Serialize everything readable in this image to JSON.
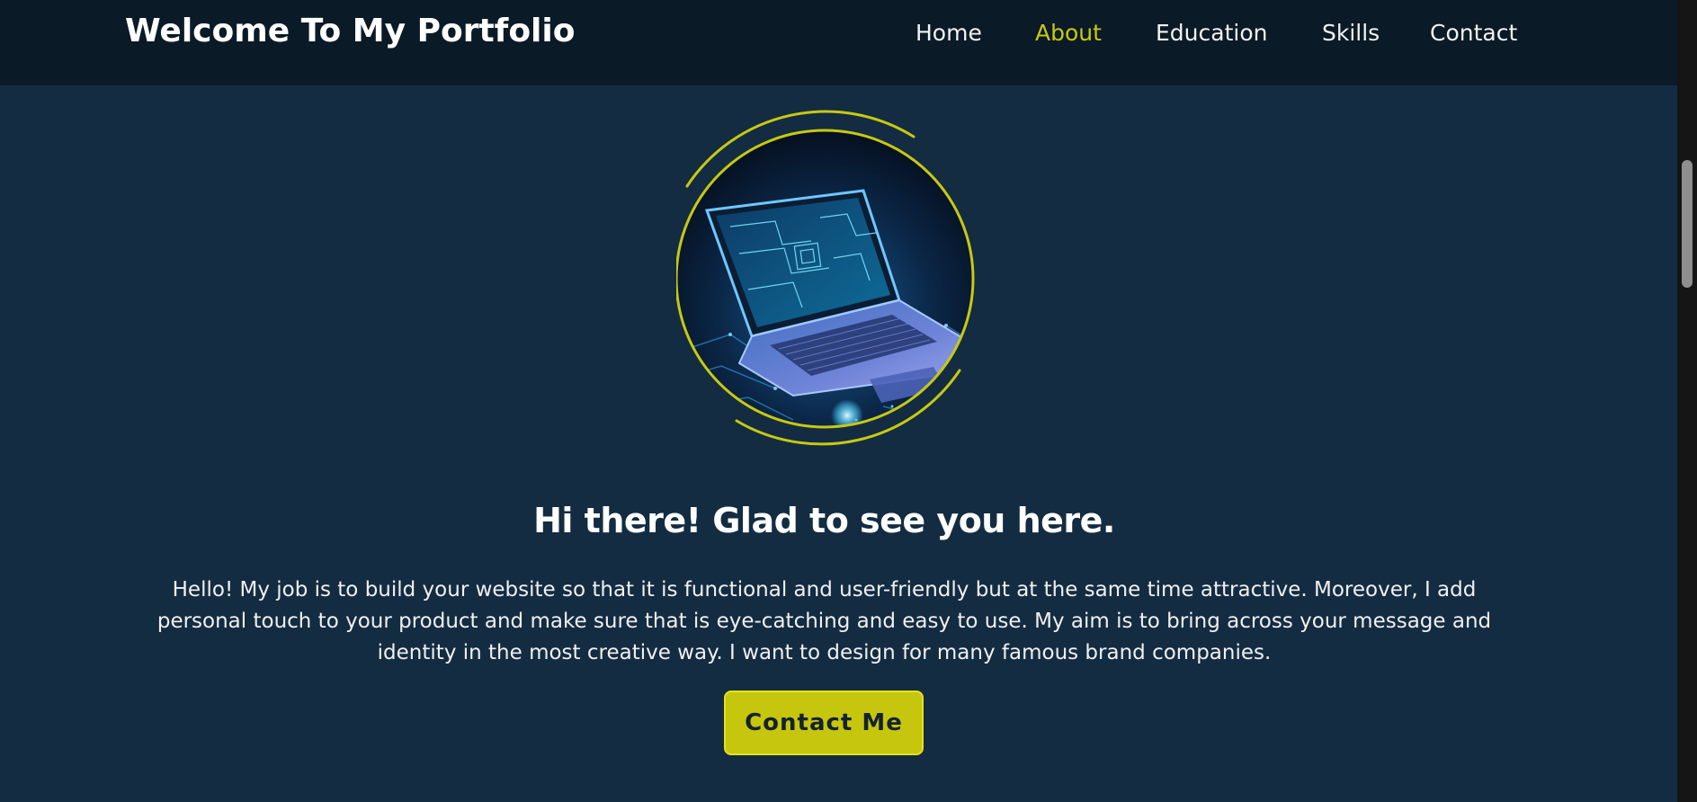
{
  "header": {
    "brand": "Welcome To My Portfolio",
    "nav": [
      {
        "label": "Home",
        "active": false
      },
      {
        "label": "About",
        "active": true
      },
      {
        "label": "Education",
        "active": false
      },
      {
        "label": "Skills",
        "active": false
      },
      {
        "label": "Contact",
        "active": false
      }
    ]
  },
  "hero": {
    "image": "laptop-circuit-image",
    "headline": "Hi there! Glad to see you here.",
    "intro": "Hello! My job is to build your website so that it is functional and user-friendly but at the same time attractive. Moreover, I add personal touch to your product and make sure that is eye-catching and easy to use. My aim is to bring across your message and identity in the most creative way. I want to design for many famous brand companies.",
    "cta_label": "Contact Me"
  },
  "colors": {
    "background": "#132c42",
    "header_bg": "#0b1a27",
    "accent": "#c7c912",
    "text": "#ffffff"
  }
}
